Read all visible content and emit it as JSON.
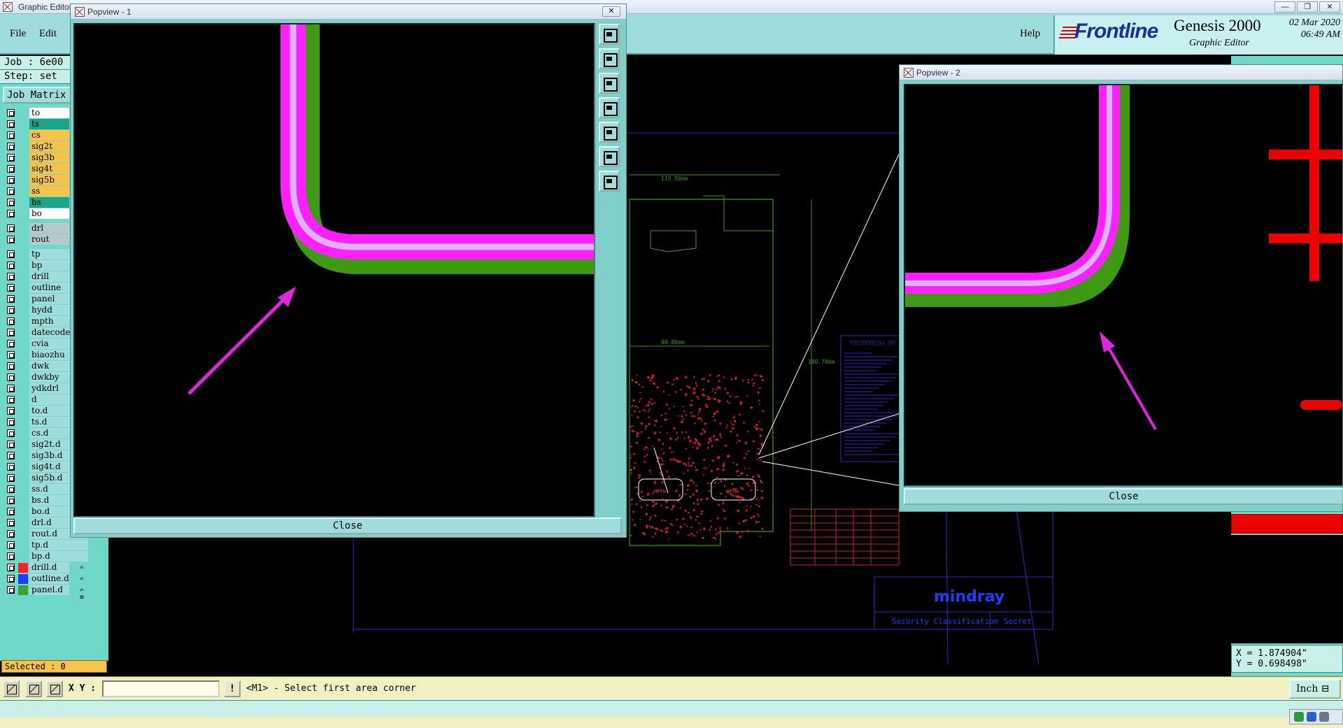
{
  "window": {
    "title": "Graphic Editor",
    "controls": {
      "minimize": "—",
      "restore": "❐",
      "close": "✕"
    }
  },
  "menubar": {
    "file": "File",
    "edit": "Edit",
    "help": "Help"
  },
  "brand": {
    "logo": "Frontline",
    "product": "Genesis 2000",
    "subtitle": "Graphic Editor",
    "date": "02 Mar 2020",
    "time": "06:49 AM"
  },
  "job_info": {
    "job": "Job : 6e00",
    "step": "Step: set"
  },
  "job_matrix_label": "Job Matrix",
  "layers_group1": [
    {
      "name": "to",
      "color": "#ffffff"
    },
    {
      "name": "ts",
      "color": "#1aa58a"
    },
    {
      "name": "cs",
      "color": "#f6c34b"
    },
    {
      "name": "sig2t",
      "color": "#f6c34b"
    },
    {
      "name": "sig3b",
      "color": "#f6c34b"
    },
    {
      "name": "sig4t",
      "color": "#f6c34b"
    },
    {
      "name": "sig5b",
      "color": "#f6c34b"
    },
    {
      "name": "ss",
      "color": "#f6c34b"
    },
    {
      "name": "bs",
      "color": "#1aa58a"
    },
    {
      "name": "bo",
      "color": "#ffffff"
    }
  ],
  "layers_group2": [
    {
      "name": "drl",
      "color": "#b9c8c8"
    },
    {
      "name": "rout",
      "color": "#b9c8c8"
    }
  ],
  "layers_group3": [
    "tp",
    "bp",
    "drill",
    "outline",
    "panel",
    "hydd",
    "mpth",
    "datecode",
    "cvia",
    "biaozhu",
    "dwk",
    "dwkby",
    "ydkdrl",
    "d",
    "to.d",
    "ts.d",
    "cs.d",
    "sig2t.d",
    "sig3b.d",
    "sig4t.d",
    "sig5b.d",
    "ss.d",
    "bs.d",
    "bo.d",
    "drl.d",
    "rout.d",
    "tp.d",
    "bp.d"
  ],
  "layers_affected": [
    {
      "name": "drill.d",
      "swatch": "#ff2020",
      "marker": "✍"
    },
    {
      "name": "outline.d",
      "swatch": "#1f3cff",
      "marker": "✍"
    },
    {
      "name": "panel.d",
      "swatch": "#3ea12b",
      "marker": "✍≡"
    }
  ],
  "selected_count": "Selected : 0",
  "popview1": {
    "title": "Popview - 1",
    "close_label": "Close",
    "close_x": "✕"
  },
  "popview2": {
    "title": "Popview - 2",
    "close_label": "Close"
  },
  "drawing": {
    "dim_top": "115.50mm",
    "dim_mid": "90.80mm",
    "dim_right": "180.70mm",
    "tech_spec": "TECHNICAL SP",
    "mpth_label": "MPTH",
    "brand_mark": "mindray",
    "security_label": "Security Classification",
    "security_value": "Secret"
  },
  "coords": {
    "x": "X = 1.874904\"",
    "y": "Y = 0.698498\""
  },
  "bottom": {
    "xy_label": "X Y :",
    "xy_value": "",
    "bang": "!",
    "message": "<M1> - Select first area corner",
    "units": "Inch ⊟"
  },
  "colors": {
    "panel": "#6fd8c8",
    "menubar": "#9fdcdc",
    "trace_magenta": "#ff1fff",
    "trace_lilac": "#d9b3ff",
    "trace_green": "#3e9a12",
    "arrow": "#e026e0"
  }
}
